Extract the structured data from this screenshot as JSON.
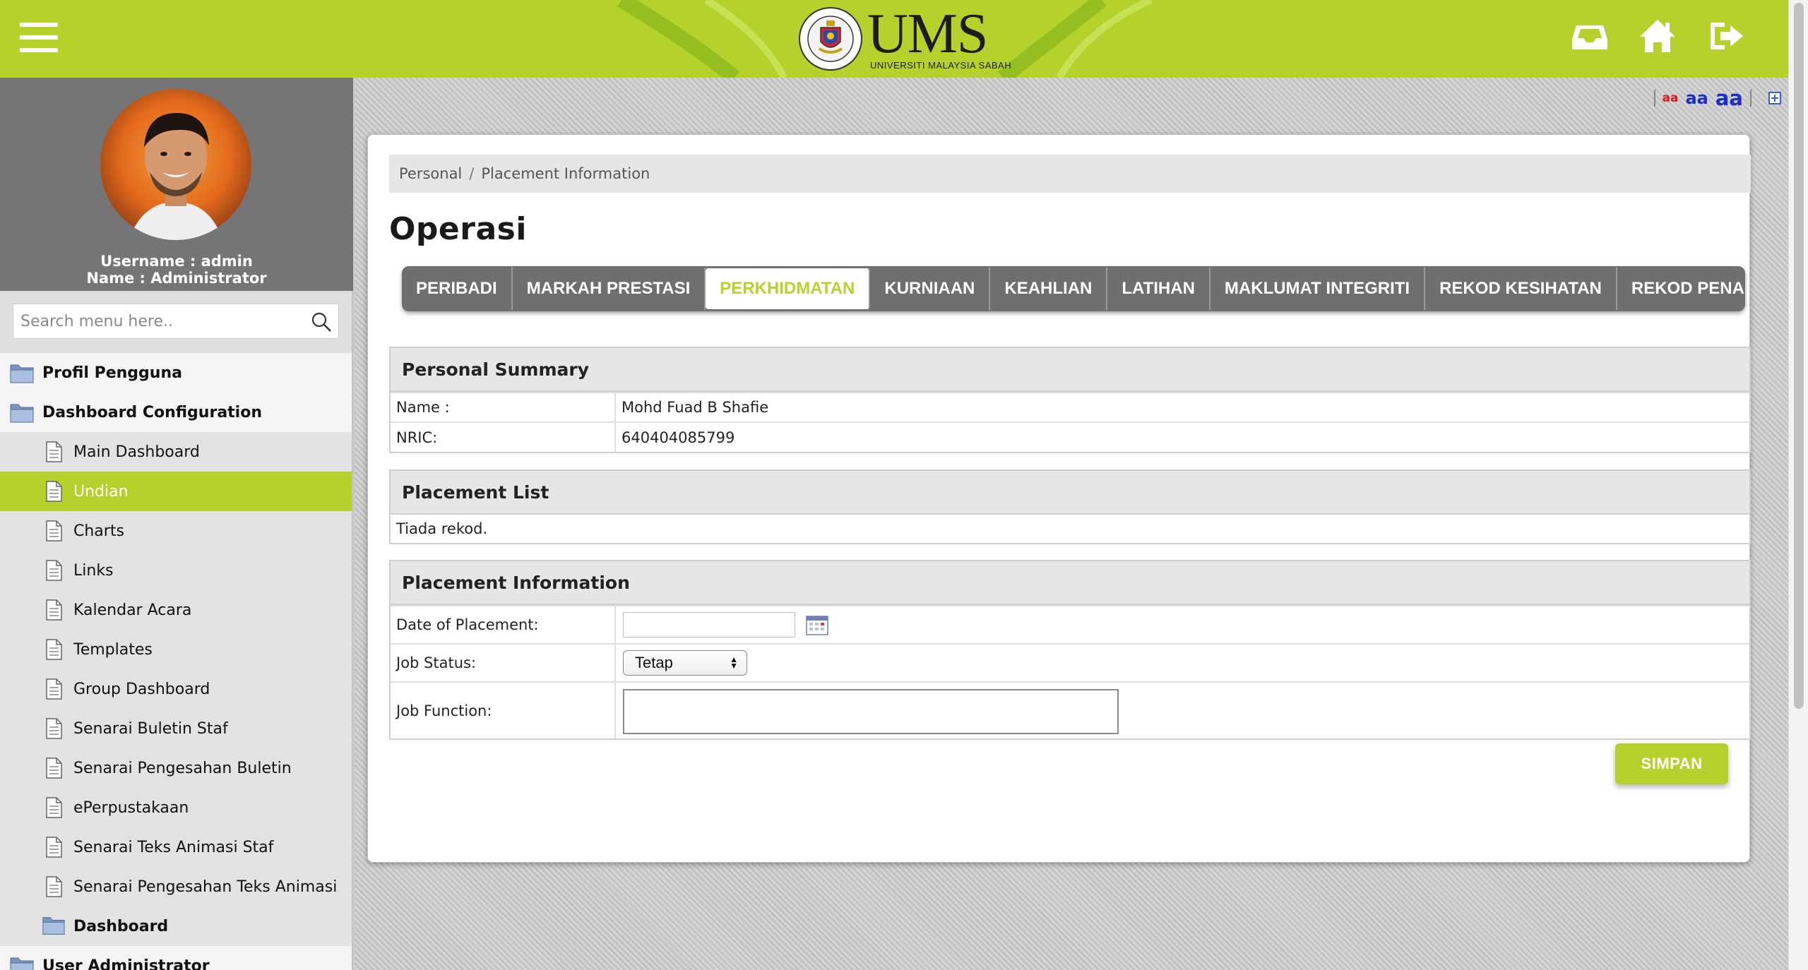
{
  "header": {
    "logo_text": "UMS",
    "logo_subtext": "UNIVERSITI MALAYSIA SABAH",
    "seal_text": "UNIVERSITI MALAYSIA SABAH",
    "icons": [
      "menu-icon",
      "inbox-icon",
      "home-icon",
      "logout-icon"
    ],
    "brand_color": "#b5d22c"
  },
  "sidebar": {
    "username_line": "Username : admin",
    "name_line": "Name : Administrator",
    "search_placeholder": "Search menu here..",
    "items": [
      {
        "label": "Profil Pengguna",
        "level": "top",
        "icon": "folder-icon"
      },
      {
        "label": "Dashboard Configuration",
        "level": "top",
        "icon": "folder-icon"
      },
      {
        "label": "Main Dashboard",
        "level": "sub",
        "icon": "document-icon"
      },
      {
        "label": "Undian",
        "level": "sub",
        "icon": "document-icon",
        "active": true
      },
      {
        "label": "Charts",
        "level": "sub",
        "icon": "document-icon"
      },
      {
        "label": "Links",
        "level": "sub",
        "icon": "document-icon"
      },
      {
        "label": "Kalendar Acara",
        "level": "sub",
        "icon": "document-icon"
      },
      {
        "label": "Templates",
        "level": "sub",
        "icon": "document-icon"
      },
      {
        "label": "Group Dashboard",
        "level": "sub",
        "icon": "document-icon"
      },
      {
        "label": "Senarai Buletin Staf",
        "level": "sub",
        "icon": "document-icon"
      },
      {
        "label": "Senarai Pengesahan Buletin",
        "level": "sub",
        "icon": "document-icon"
      },
      {
        "label": "ePerpustakaan",
        "level": "sub",
        "icon": "document-icon"
      },
      {
        "label": "Senarai Teks Animasi Staf",
        "level": "sub",
        "icon": "document-icon"
      },
      {
        "label": "Senarai Pengesahan Teks Animasi",
        "level": "sub",
        "icon": "document-icon"
      },
      {
        "label": "Dashboard",
        "level": "sub-folder",
        "icon": "folder-icon"
      },
      {
        "label": "User Administrator",
        "level": "top",
        "icon": "folder-icon"
      }
    ]
  },
  "font_size_controls": {
    "small": "aa",
    "medium": "aa",
    "large": "aa"
  },
  "main": {
    "breadcrumb": [
      "Personal",
      "Placement Information"
    ],
    "breadcrumb_separator": "/",
    "title": "Operasi",
    "tabs": [
      {
        "label": "PERIBADI"
      },
      {
        "label": "MARKAH PRESTASI"
      },
      {
        "label": "PERKHIDMATAN",
        "active": true
      },
      {
        "label": "KURNIAAN"
      },
      {
        "label": "KEAHLIAN"
      },
      {
        "label": "LATIHAN"
      },
      {
        "label": "MAKLUMAT INTEGRITI"
      },
      {
        "label": "REKOD KESIHATAN"
      },
      {
        "label": "REKOD PENAMA"
      }
    ],
    "personal_summary": {
      "title": "Personal Summary",
      "name_label": "Name :",
      "name_value": "Mohd Fuad B Shafie",
      "nric_label": "NRIC:",
      "nric_value": "640404085799"
    },
    "placement_list": {
      "title": "Placement List",
      "empty_text": "Tiada rekod."
    },
    "placement_info": {
      "title": "Placement Information",
      "date_label": "Date of Placement:",
      "date_value": "",
      "status_label": "Job Status:",
      "status_value": "Tetap",
      "function_label": "Job Function:",
      "function_value": ""
    },
    "save_button": "SIMPAN"
  }
}
